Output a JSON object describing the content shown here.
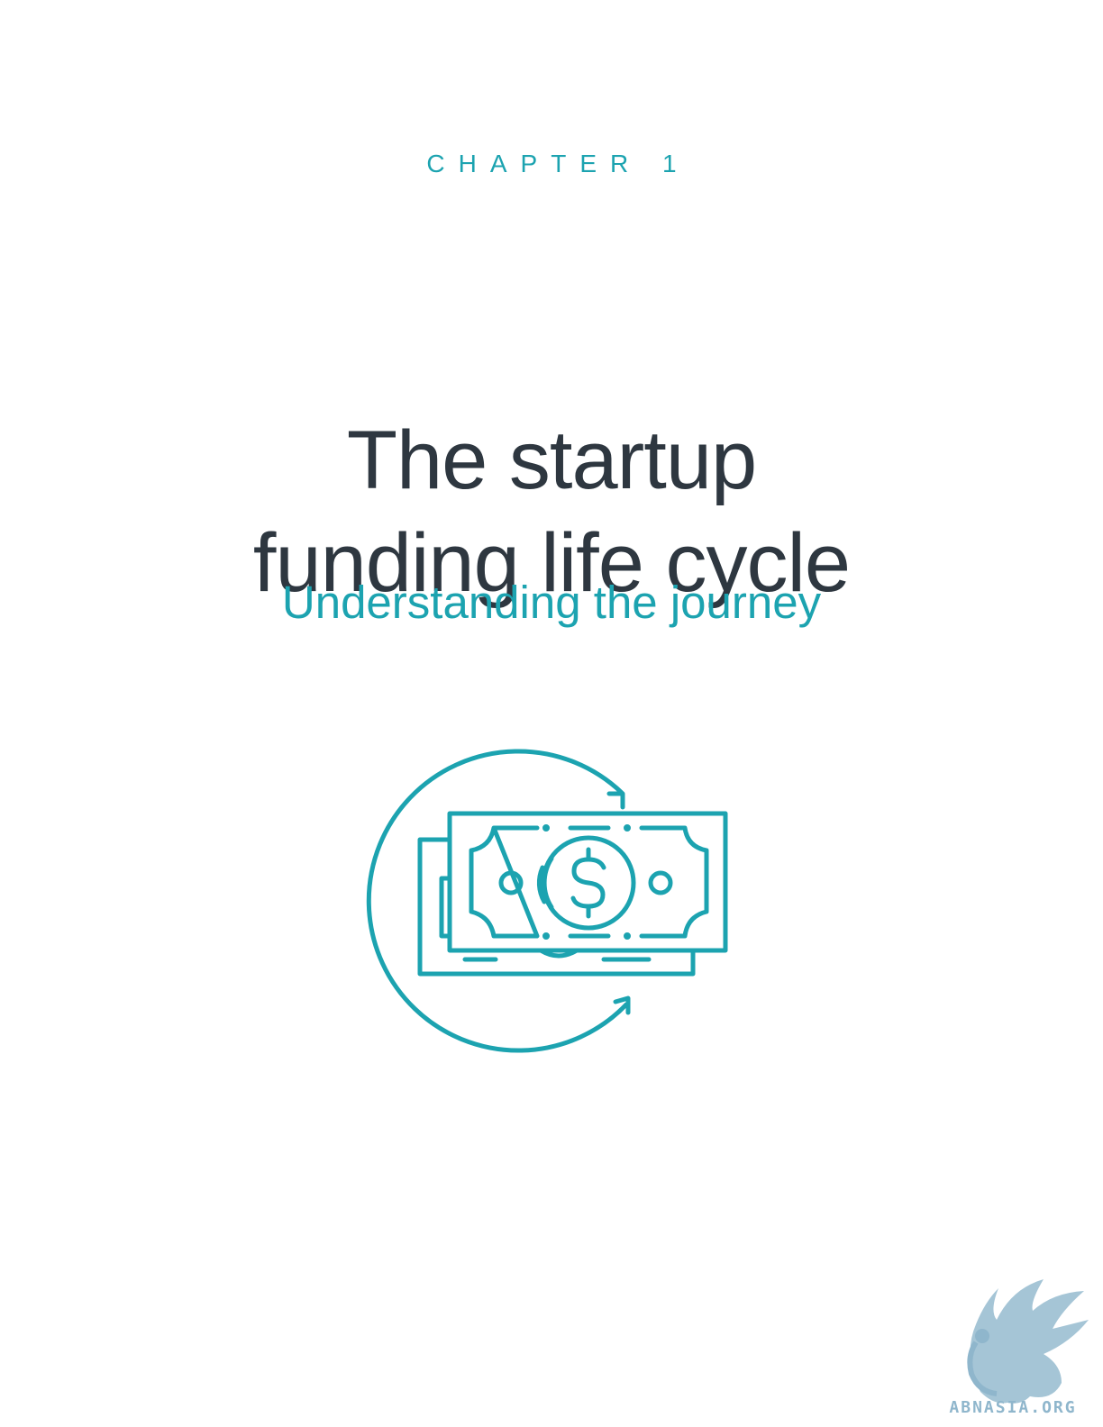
{
  "chapter": {
    "label": "CHAPTER 1"
  },
  "title": {
    "line1": "The startup",
    "line2": "funding life cycle"
  },
  "subtitle": "Understanding the journey",
  "illustration": {
    "icon": "money-cycle-icon",
    "accent_color": "#1ca3b0"
  },
  "watermark": {
    "icon": "griffin-logo",
    "text": "ABNASIA.ORG",
    "color": "#8fb6cc"
  },
  "colors": {
    "accent": "#1ca3b0",
    "heading": "#2e3740",
    "background": "#ffffff"
  }
}
